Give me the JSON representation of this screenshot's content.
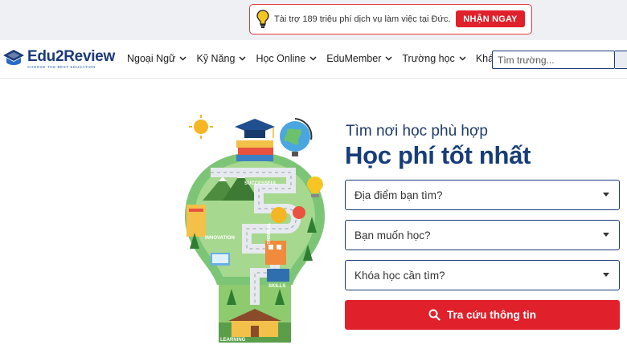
{
  "promo": {
    "text": "Tài trợ 189 triệu phí dịch vụ làm việc tại Đức.",
    "button": "NHẬN NGAY",
    "icon": "lightbulb-icon"
  },
  "header": {
    "logo_name": "Edu2Review",
    "logo_tagline": "CHOOSE THE BEST EDUCATION",
    "nav": [
      {
        "label": "Ngoại Ngữ"
      },
      {
        "label": "Kỹ Năng"
      },
      {
        "label": "Học Online"
      },
      {
        "label": "EduMember"
      },
      {
        "label": "Trường học"
      },
      {
        "label": "Khác"
      }
    ],
    "search_placeholder": "Tìm trường..."
  },
  "hero": {
    "subtitle": "Tìm nơi học phù hợp",
    "title": "Học phí tốt nhất",
    "selects": [
      {
        "placeholder": "Địa điểm bạn tìm?"
      },
      {
        "placeholder": "Bạn muốn học?"
      },
      {
        "placeholder": "Khóa học cần tìm?"
      }
    ],
    "cta": "Tra cứu thông tin"
  },
  "illustration": {
    "labels": [
      "SUCCESSFUL",
      "TRAINING",
      "INNOVATION",
      "SKILLS",
      "LEARNING"
    ]
  },
  "colors": {
    "brand_blue": "#173d7a",
    "accent_red": "#e0202a",
    "leaf_green": "#5cb85c"
  }
}
